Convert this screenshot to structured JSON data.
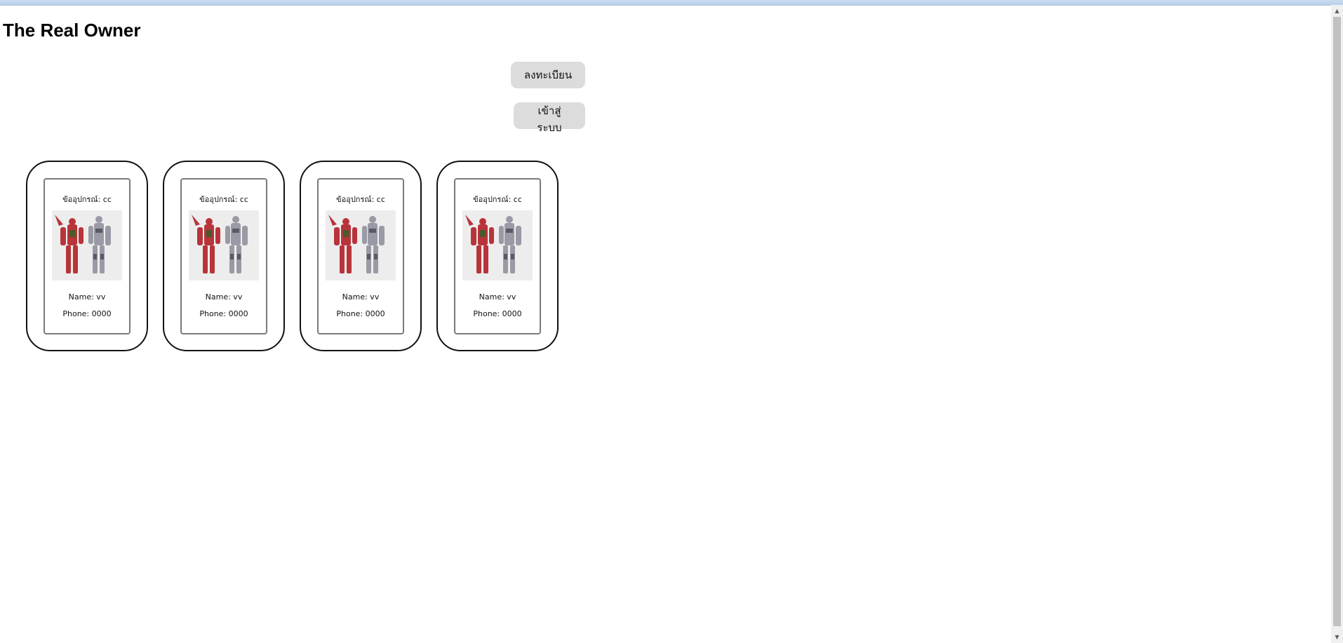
{
  "page": {
    "title": "The Real Owner"
  },
  "actions": {
    "register_label": "ลงทะเบียน",
    "login_label": "เข้าสู่ระบบ"
  },
  "devices": [
    {
      "device_text": "ข้ออุปกรณ์: cc",
      "name_text": "Name: vv",
      "phone_text": "Phone: 0000",
      "image_icon": "gundam-robots-image"
    },
    {
      "device_text": "ข้ออุปกรณ์: cc",
      "name_text": "Name: vv",
      "phone_text": "Phone: 0000",
      "image_icon": "gundam-robots-image"
    },
    {
      "device_text": "ข้ออุปกรณ์: cc",
      "name_text": "Name: vv",
      "phone_text": "Phone: 0000",
      "image_icon": "gundam-robots-image"
    },
    {
      "device_text": "ข้ออุปกรณ์: cc",
      "name_text": "Name: vv",
      "phone_text": "Phone: 0000",
      "image_icon": "gundam-robots-image"
    }
  ],
  "colors": {
    "card_border": "#111111",
    "button_bg": "#dcdcdc",
    "robot_red": "#b8343a",
    "robot_grey": "#9a9aa6"
  }
}
